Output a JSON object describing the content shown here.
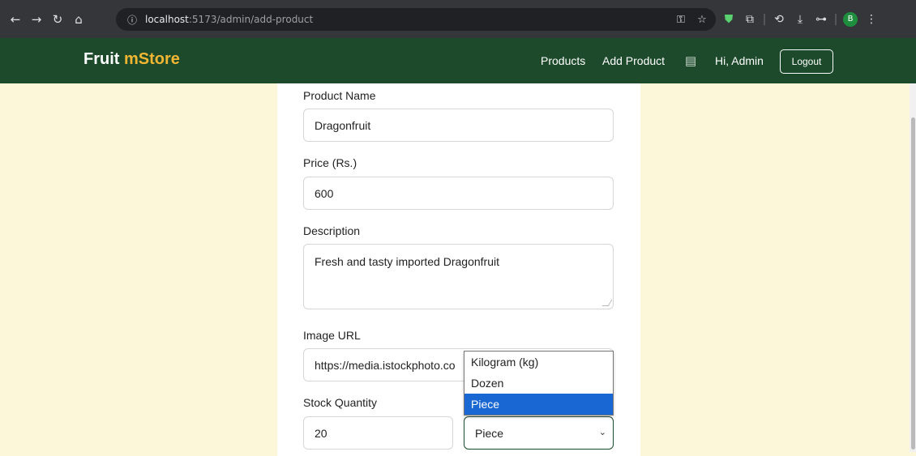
{
  "browser": {
    "url_host": "localhost",
    "url_path": ":5173/admin/add-product",
    "avatar_letter": "B"
  },
  "navbar": {
    "brand_part1": "Fruit",
    "brand_part2": "mStore",
    "links": [
      "Products",
      "Add Product"
    ],
    "greeting": "Hi, Admin",
    "logout_label": "Logout"
  },
  "form": {
    "name_label": "Product Name",
    "name_value": "Dragonfruit",
    "price_label": "Price (Rs.)",
    "price_value": "600",
    "description_label": "Description",
    "description_value": "Fresh and tasty imported Dragonfruit",
    "image_label": "Image URL",
    "image_value": "https://media.istockphoto.co",
    "stock_label": "Stock Quantity",
    "stock_value": "20",
    "unit_selected": "Piece",
    "unit_options": [
      "Kilogram (kg)",
      "Dozen",
      "Piece"
    ]
  },
  "colors": {
    "navbar": "#1c4a2b",
    "brand_accent": "#f2b632",
    "page_bg": "#fdf7d9",
    "option_highlight": "#1967d2"
  }
}
